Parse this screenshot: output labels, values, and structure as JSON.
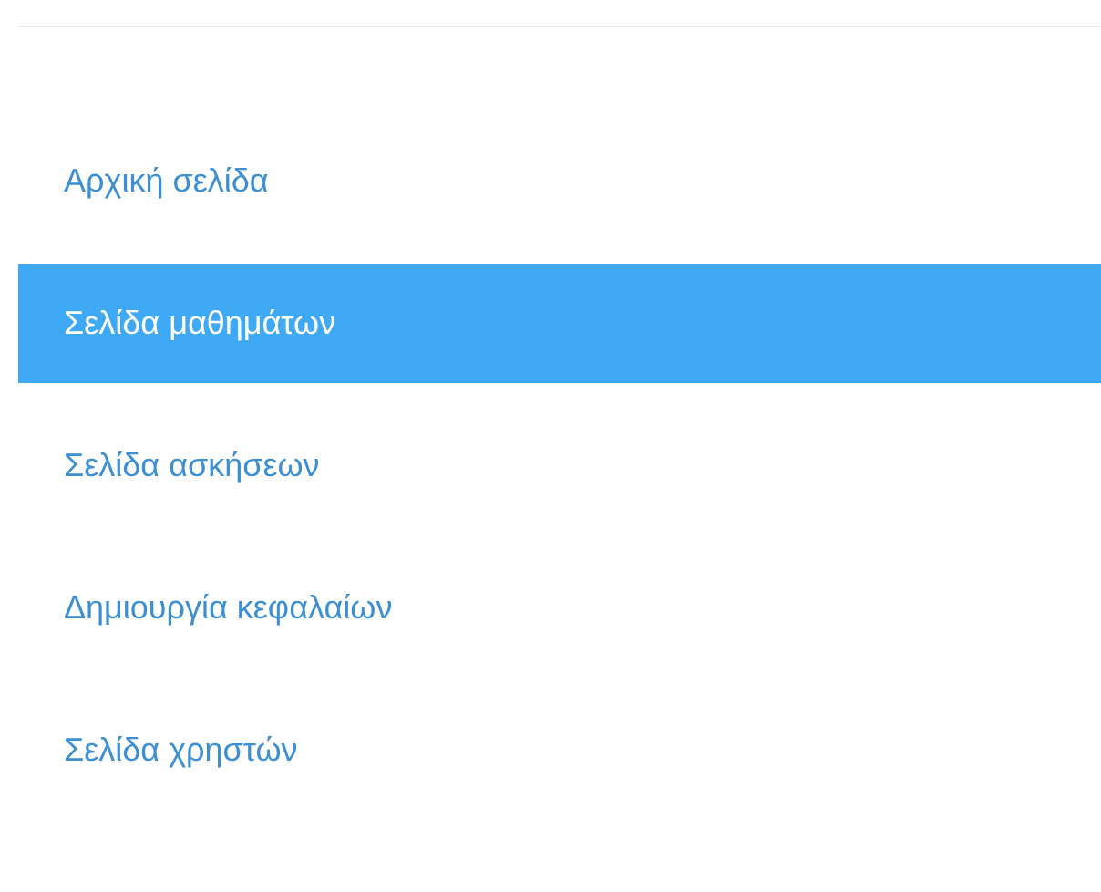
{
  "nav": {
    "items": [
      {
        "label": "Αρχική σελίδα",
        "selected": false
      },
      {
        "label": "Σελίδα μαθημάτων",
        "selected": true
      },
      {
        "label": "Σελίδα ασκήσεων",
        "selected": false
      },
      {
        "label": "Δημιουργία κεφαλαίων",
        "selected": false
      },
      {
        "label": "Σελίδα χρηστών",
        "selected": false
      }
    ]
  }
}
